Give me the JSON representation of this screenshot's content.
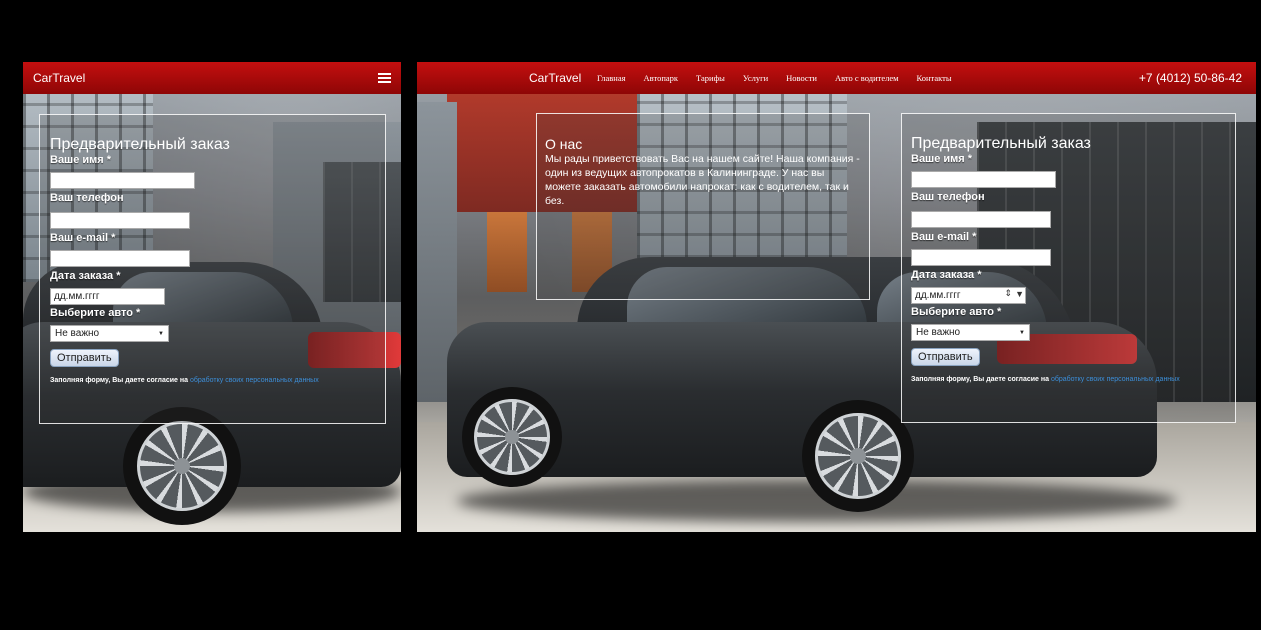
{
  "brand": "CarTravel",
  "nav": {
    "items": [
      "Главная",
      "Автопарк",
      "Тарифы",
      "Услуги",
      "Новости",
      "Авто с водителем",
      "Контакты"
    ],
    "phone": "+7 (4012) 50-86-42"
  },
  "about": {
    "title": "О нас",
    "text": "Мы рады приветствовать Вас на нашем сайте! Наша компания - один из ведущих автопрокатов в Калининграде. У нас вы можете заказать автомобили напрокат: как с водителем, так и без."
  },
  "form": {
    "title": "Предварительный заказ",
    "name_label": "Ваше имя *",
    "phone_label": "Ваш телефон",
    "email_label": "Ваш e-mail *",
    "date_label": "Дата заказа *",
    "date_placeholder": "дд.мм.гггг",
    "car_label": "Выберите авто *",
    "car_selected": "Не важно",
    "submit": "Отправить",
    "consent_text": "Заполняя форму, Вы даете согласие на ",
    "consent_link": "обработку своих персональных данных"
  },
  "colors": {
    "navbar": "#b00a0a",
    "link": "#3c8ed8",
    "background": "#000000"
  },
  "icons": [
    "hamburger-menu-icon",
    "select-arrow-icon",
    "date-spinner-icon",
    "date-dropdown-icon"
  ]
}
